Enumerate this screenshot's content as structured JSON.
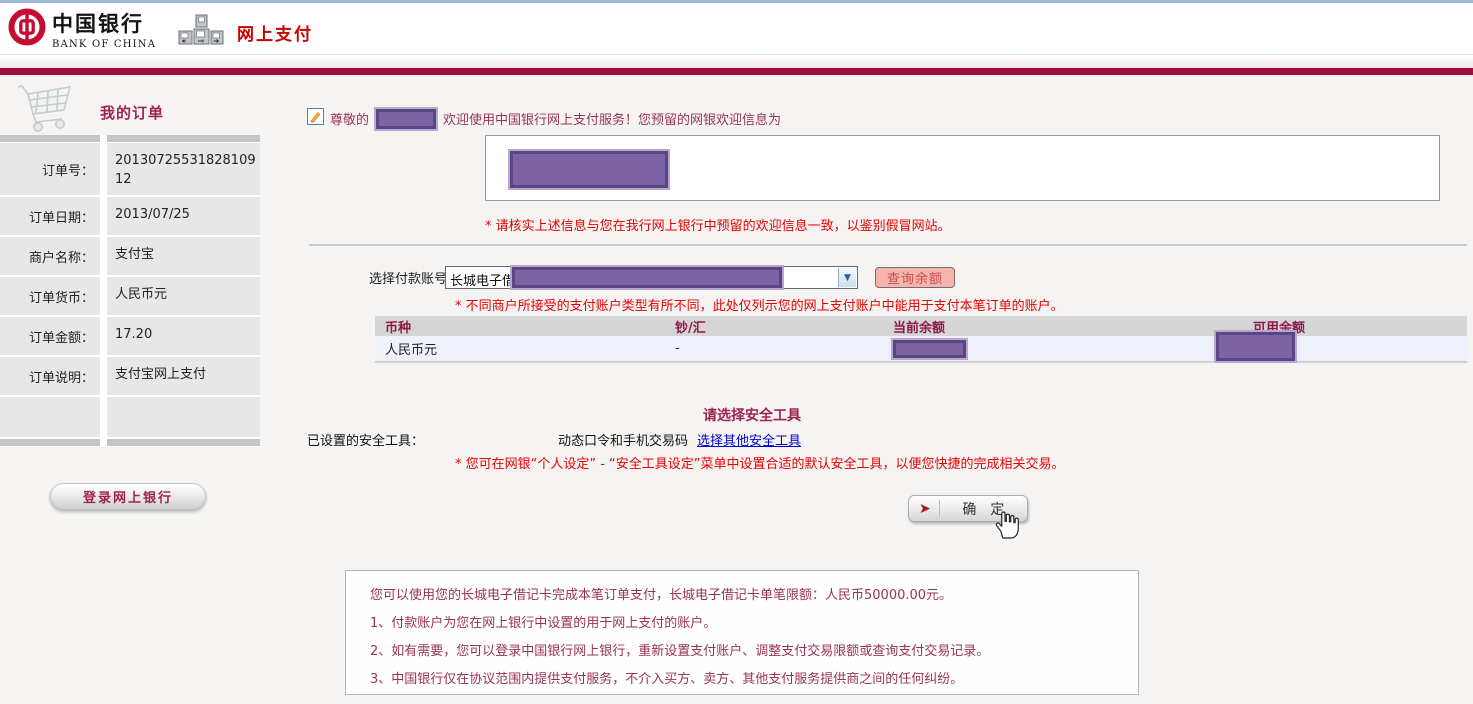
{
  "header": {
    "bank_name_cn": "中国银行",
    "bank_name_en": "BANK OF CHINA",
    "page_title": "网上支付"
  },
  "sidebar": {
    "title": "我的订单",
    "fields": [
      {
        "label": "订单号：",
        "value": "2013072553182810912"
      },
      {
        "label": "订单日期：",
        "value": "2013/07/25"
      },
      {
        "label": "商户名称：",
        "value": "支付宝"
      },
      {
        "label": "订单货币：",
        "value": "人民币元"
      },
      {
        "label": "订单金额：",
        "value": "17.20"
      },
      {
        "label": "订单说明：",
        "value": "支付宝网上支付"
      }
    ],
    "login_button": "登录网上银行"
  },
  "main": {
    "welcome": {
      "prefix": "尊敬的",
      "suffix": "欢迎使用中国银行网上支付服务！您预留的网银欢迎信息为",
      "note": "* 请核实上述信息与您在我行网上银行中预留的欢迎信息一致，以鉴别假冒网站。"
    },
    "payment": {
      "label": "选择付款账号：",
      "account_prefix": "长城电子借记卡",
      "query_button": "查询余额",
      "note": "* 不同商户所接受的支付账户类型有所不同，此处仅列示您的网上支付账户中能用于支付本笔订单的账户。"
    },
    "balance_table": {
      "headers": [
        "币种",
        "钞/汇",
        "当前余额",
        "可用余额"
      ],
      "row": {
        "currency": "人民币元",
        "cash_exchange": "-",
        "current_balance": "[已遮盖]",
        "available_balance": "[已遮盖]"
      }
    },
    "security": {
      "title": "请选择安全工具",
      "label": "已设置的安全工具：",
      "tool": "动态口令和手机交易码",
      "link": "选择其他安全工具",
      "note": "* 您可在网银“个人设定” - “安全工具设定”菜单中设置合适的默认安全工具，以便您快捷的完成相关交易。"
    },
    "confirm_button": "确　定",
    "notice": {
      "intro": "您可以使用您的长城电子借记卡完成本笔订单支付，长城电子借记卡单笔限额：人民币50000.00元。",
      "items": [
        "1、付款账户为您在网上银行中设置的用于网上支付的账户。",
        "2、如有需要，您可以登录中国银行网上银行，重新设置支付账户、调整支付交易限额或查询支付交易记录。",
        "3、中国银行仅在协议范围内提供支付服务，不介入买方、卖方、其他支付服务提供商之间的任何纠纷。"
      ]
    }
  },
  "icons": {
    "logo": "bank-of-china-logo",
    "kiosk": "online-payment-kiosk-icon",
    "cart": "shopping-cart-icon",
    "note": "note-edit-icon",
    "select_arrow": "chevron-down-icon",
    "confirm_arrow": "red-arrow-icon",
    "hand": "hand-cursor-icon"
  },
  "colors": {
    "maroon_bar": "#9a0e3d",
    "heading_red": "#9e2350",
    "alert_red": "#e80000",
    "notice_text": "#993355",
    "link_blue": "#0000cc",
    "redaction_fill": "#7c63a6",
    "redaction_border": "#5a4781",
    "pink_button": "#f7b3ae",
    "boc_logo_red": "#c60c30",
    "table_header_bg": "#d5d5d5",
    "table_row_bg": "#eef0fa"
  }
}
